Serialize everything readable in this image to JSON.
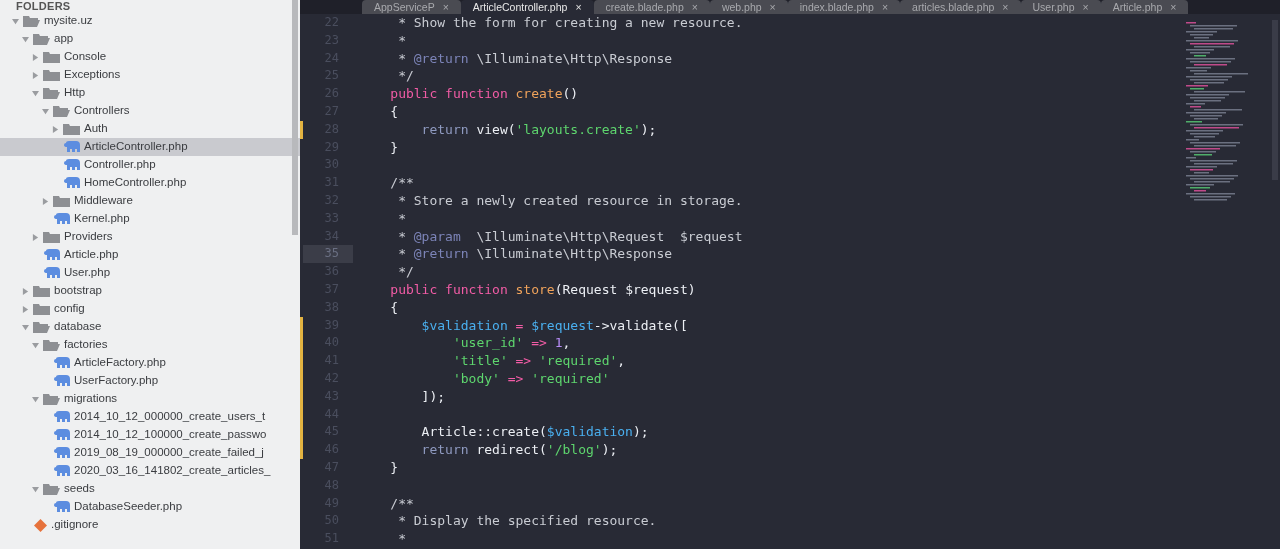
{
  "sidebar": {
    "header": "FOLDERS",
    "tree": [
      {
        "kind": "folder",
        "label": "mysite.uz",
        "expanded": true,
        "selected": false,
        "children": [
          {
            "kind": "folder",
            "label": "app",
            "expanded": true,
            "selected": false,
            "children": [
              {
                "kind": "folder",
                "label": "Console",
                "expanded": false,
                "selected": false
              },
              {
                "kind": "folder",
                "label": "Exceptions",
                "expanded": false,
                "selected": false
              },
              {
                "kind": "folder",
                "label": "Http",
                "expanded": true,
                "selected": false,
                "children": [
                  {
                    "kind": "folder",
                    "label": "Controllers",
                    "expanded": true,
                    "selected": false,
                    "children": [
                      {
                        "kind": "folder",
                        "label": "Auth",
                        "expanded": false,
                        "selected": false
                      },
                      {
                        "kind": "php",
                        "label": "ArticleController.php",
                        "selected": true
                      },
                      {
                        "kind": "php",
                        "label": "Controller.php",
                        "selected": false
                      },
                      {
                        "kind": "php",
                        "label": "HomeController.php",
                        "selected": false
                      }
                    ]
                  },
                  {
                    "kind": "folder",
                    "label": "Middleware",
                    "expanded": false,
                    "selected": false
                  },
                  {
                    "kind": "php",
                    "label": "Kernel.php",
                    "selected": false
                  }
                ]
              },
              {
                "kind": "folder",
                "label": "Providers",
                "expanded": false,
                "selected": false
              },
              {
                "kind": "php",
                "label": "Article.php",
                "selected": false
              },
              {
                "kind": "php",
                "label": "User.php",
                "selected": false
              }
            ]
          },
          {
            "kind": "folder",
            "label": "bootstrap",
            "expanded": false,
            "selected": false
          },
          {
            "kind": "folder",
            "label": "config",
            "expanded": false,
            "selected": false
          },
          {
            "kind": "folder",
            "label": "database",
            "expanded": true,
            "selected": false,
            "children": [
              {
                "kind": "folder",
                "label": "factories",
                "expanded": true,
                "selected": false,
                "children": [
                  {
                    "kind": "php",
                    "label": "ArticleFactory.php",
                    "selected": false
                  },
                  {
                    "kind": "php",
                    "label": "UserFactory.php",
                    "selected": false
                  }
                ]
              },
              {
                "kind": "folder",
                "label": "migrations",
                "expanded": true,
                "selected": false,
                "children": [
                  {
                    "kind": "php",
                    "label": "2014_10_12_000000_create_users_t",
                    "selected": false
                  },
                  {
                    "kind": "php",
                    "label": "2014_10_12_100000_create_passwo",
                    "selected": false
                  },
                  {
                    "kind": "php",
                    "label": "2019_08_19_000000_create_failed_j",
                    "selected": false
                  },
                  {
                    "kind": "php",
                    "label": "2020_03_16_141802_create_articles_",
                    "selected": false
                  }
                ]
              },
              {
                "kind": "folder",
                "label": "seeds",
                "expanded": true,
                "selected": false,
                "children": [
                  {
                    "kind": "php",
                    "label": "DatabaseSeeder.php",
                    "selected": false
                  }
                ]
              }
            ]
          },
          {
            "kind": "git",
            "label": ".gitignore",
            "selected": false
          }
        ]
      }
    ]
  },
  "tabs": [
    {
      "label": "AppServiceP",
      "selected": false
    },
    {
      "label": "ArticleController.php",
      "selected": true
    },
    {
      "label": "create.blade.php",
      "selected": false
    },
    {
      "label": "web.php",
      "selected": false
    },
    {
      "label": "index.blade.php",
      "selected": false
    },
    {
      "label": "articles.blade.php",
      "selected": false
    },
    {
      "label": "User.php",
      "selected": false
    },
    {
      "label": "Article.php",
      "selected": false
    }
  ],
  "tab_close": "×",
  "code_lines": [
    {
      "number": "22",
      "current": false,
      "modified": false,
      "tokens": [
        {
          "kind": "comment",
          "text": "     * Show the form for creating a new resource."
        }
      ]
    },
    {
      "number": "23",
      "current": false,
      "modified": false,
      "tokens": [
        {
          "kind": "comment",
          "text": "     *"
        }
      ]
    },
    {
      "number": "24",
      "current": false,
      "modified": false,
      "tokens": [
        {
          "kind": "comment",
          "text": "     * "
        },
        {
          "kind": "doctag",
          "text": "@return"
        },
        {
          "kind": "comment",
          "text": " \\Illuminate\\Http\\Response"
        }
      ]
    },
    {
      "number": "25",
      "current": false,
      "modified": false,
      "tokens": [
        {
          "kind": "comment",
          "text": "     */"
        }
      ]
    },
    {
      "number": "26",
      "current": false,
      "modified": false,
      "tokens": [
        {
          "kind": "keyword",
          "text": "    public function "
        },
        {
          "kind": "function",
          "text": "create"
        },
        {
          "kind": "plain",
          "text": "()"
        }
      ]
    },
    {
      "number": "27",
      "current": false,
      "modified": false,
      "tokens": [
        {
          "kind": "plain",
          "text": "    {"
        }
      ]
    },
    {
      "number": "28",
      "current": false,
      "modified": true,
      "tokens": [
        {
          "kind": "return",
          "text": "        return "
        },
        {
          "kind": "plain",
          "text": "view("
        },
        {
          "kind": "string",
          "text": "'layouts.create'"
        },
        {
          "kind": "plain",
          "text": ");"
        }
      ]
    },
    {
      "number": "29",
      "current": false,
      "modified": false,
      "tokens": [
        {
          "kind": "plain",
          "text": "    }"
        }
      ]
    },
    {
      "number": "30",
      "current": false,
      "modified": false
    },
    {
      "number": "31",
      "current": false,
      "modified": false,
      "tokens": [
        {
          "kind": "comment",
          "text": "    /**"
        }
      ]
    },
    {
      "number": "32",
      "current": false,
      "modified": false,
      "tokens": [
        {
          "kind": "comment",
          "text": "     * Store a newly created resource in storage."
        }
      ]
    },
    {
      "number": "33",
      "current": false,
      "modified": false,
      "tokens": [
        {
          "kind": "comment",
          "text": "     *"
        }
      ]
    },
    {
      "number": "34",
      "current": false,
      "modified": false,
      "tokens": [
        {
          "kind": "comment",
          "text": "     * "
        },
        {
          "kind": "doctag",
          "text": "@param"
        },
        {
          "kind": "comment",
          "text": "  \\Illuminate\\Http\\Request  $request"
        }
      ]
    },
    {
      "number": "35",
      "current": true,
      "modified": false,
      "tokens": [
        {
          "kind": "comment",
          "text": "     * "
        },
        {
          "kind": "doctag",
          "text": "@return"
        },
        {
          "kind": "comment",
          "text": " \\Illuminate\\Http\\Response"
        }
      ]
    },
    {
      "number": "36",
      "current": false,
      "modified": false,
      "tokens": [
        {
          "kind": "comment",
          "text": "     */"
        }
      ]
    },
    {
      "number": "37",
      "current": false,
      "modified": false,
      "tokens": [
        {
          "kind": "keyword",
          "text": "    public function "
        },
        {
          "kind": "function",
          "text": "store"
        },
        {
          "kind": "plain",
          "text": "(Request $request)"
        }
      ]
    },
    {
      "number": "38",
      "current": false,
      "modified": false,
      "tokens": [
        {
          "kind": "plain",
          "text": "    {"
        }
      ]
    },
    {
      "number": "39",
      "current": false,
      "modified": true,
      "tokens": [
        {
          "kind": "variable",
          "text": "        $validation"
        },
        {
          "kind": "operator",
          "text": " = "
        },
        {
          "kind": "variable",
          "text": "$request"
        },
        {
          "kind": "plain",
          "text": "->validate(["
        }
      ]
    },
    {
      "number": "40",
      "current": false,
      "modified": true,
      "tokens": [
        {
          "kind": "string",
          "text": "            'user_id'"
        },
        {
          "kind": "operator",
          "text": " => "
        },
        {
          "kind": "number",
          "text": "1"
        },
        {
          "kind": "plain",
          "text": ","
        }
      ]
    },
    {
      "number": "41",
      "current": false,
      "modified": true,
      "tokens": [
        {
          "kind": "string",
          "text": "            'title'"
        },
        {
          "kind": "operator",
          "text": " => "
        },
        {
          "kind": "string",
          "text": "'required'"
        },
        {
          "kind": "plain",
          "text": ","
        }
      ]
    },
    {
      "number": "42",
      "current": false,
      "modified": true,
      "tokens": [
        {
          "kind": "string",
          "text": "            'body'"
        },
        {
          "kind": "operator",
          "text": " => "
        },
        {
          "kind": "string",
          "text": "'required'"
        }
      ]
    },
    {
      "number": "43",
      "current": false,
      "modified": true,
      "tokens": [
        {
          "kind": "plain",
          "text": "        ]);"
        }
      ]
    },
    {
      "number": "44",
      "current": false,
      "modified": true
    },
    {
      "number": "45",
      "current": false,
      "modified": true,
      "tokens": [
        {
          "kind": "plain",
          "text": "        Article::create("
        },
        {
          "kind": "variable",
          "text": "$validation"
        },
        {
          "kind": "plain",
          "text": ");"
        }
      ]
    },
    {
      "number": "46",
      "current": false,
      "modified": true,
      "tokens": [
        {
          "kind": "return",
          "text": "        return "
        },
        {
          "kind": "plain",
          "text": "redirect("
        },
        {
          "kind": "string",
          "text": "'/blog'"
        },
        {
          "kind": "plain",
          "text": ");"
        }
      ]
    },
    {
      "number": "47",
      "current": false,
      "modified": false,
      "tokens": [
        {
          "kind": "plain",
          "text": "    }"
        }
      ]
    },
    {
      "number": "48",
      "current": false,
      "modified": false
    },
    {
      "number": "49",
      "current": false,
      "modified": false,
      "tokens": [
        {
          "kind": "comment",
          "text": "    /**"
        }
      ]
    },
    {
      "number": "50",
      "current": false,
      "modified": false,
      "tokens": [
        {
          "kind": "comment",
          "text": "     * Display the specified resource."
        }
      ]
    },
    {
      "number": "51",
      "current": false,
      "modified": false,
      "tokens": [
        {
          "kind": "comment",
          "text": "     *"
        }
      ]
    }
  ]
}
